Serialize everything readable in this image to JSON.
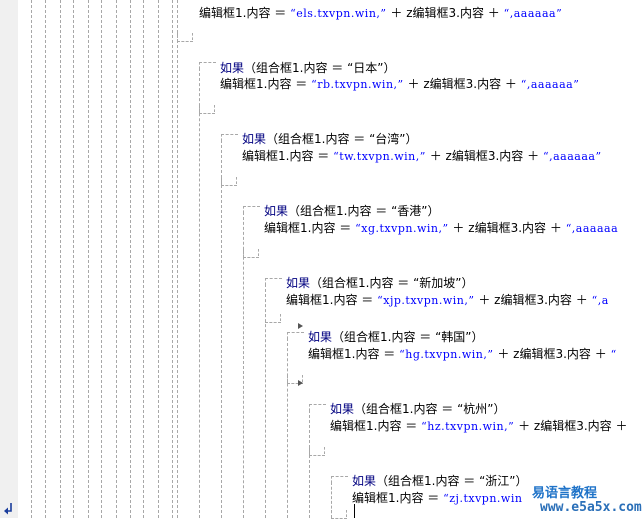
{
  "lines": [
    {
      "field": "编辑框1.内容",
      "op": "＝",
      "str": "“els.txvpn.win,”",
      "plus1": "＋",
      "field3": "z编辑框3.内容",
      "plus2": "＋",
      "tail": "“,aaaaaa”"
    },
    {
      "kw": "如果",
      "cond": "（组合框1.内容 ＝ “日本”）"
    },
    {
      "field": "编辑框1.内容",
      "op": "＝",
      "str": "“rb.txvpn.win,”",
      "plus1": "＋",
      "field3": "z编辑框3.内容",
      "plus2": "＋",
      "tail": "“,aaaaaa”"
    },
    {
      "kw": "如果",
      "cond": "（组合框1.内容 ＝ “台湾”）"
    },
    {
      "field": "编辑框1.内容",
      "op": "＝",
      "str": "“tw.txvpn.win,”",
      "plus1": "＋",
      "field3": "z编辑框3.内容",
      "plus2": "＋",
      "tail": "“,aaaaaa”"
    },
    {
      "kw": "如果",
      "cond": "（组合框1.内容 ＝ “香港”）"
    },
    {
      "field": "编辑框1.内容",
      "op": "＝",
      "str": "“xg.txvpn.win,”",
      "plus1": "＋",
      "field3": "z编辑框3.内容",
      "plus2": "＋",
      "tail": "“,aaaaaa"
    },
    {
      "kw": "如果",
      "cond": "（组合框1.内容 ＝ “新加坡”）"
    },
    {
      "field": "编辑框1.内容",
      "op": "＝",
      "str": "“xjp.txvpn.win,”",
      "plus1": "＋",
      "field3": "z编辑框3.内容",
      "plus2": "＋",
      "tail": "“,a"
    },
    {
      "kw": "如果",
      "cond": "（组合框1.内容 ＝ “韩国”）"
    },
    {
      "field": "编辑框1.内容",
      "op": "＝",
      "str": "“hg.txvpn.win,”",
      "plus1": "＋",
      "field3": "z编辑框3.内容",
      "plus2": "＋",
      "tail": "“"
    },
    {
      "kw": "如果",
      "cond": "（组合框1.内容 ＝ “杭州”）"
    },
    {
      "field": "编辑框1.内容",
      "op": "＝",
      "str": "“hz.txvpn.win,”",
      "plus1": "＋",
      "field3": "z编辑框3.内容",
      "plus2": "＋",
      "tail": ""
    },
    {
      "kw": "如果",
      "cond": "（组合框1.内容 ＝ “浙江”）"
    },
    {
      "field": "编辑框1.内容",
      "op": "＝",
      "str": "“zj.txvpn.win",
      "plus1": "",
      "field3": "",
      "plus2": "",
      "tail": ""
    }
  ],
  "watermark": {
    "line1": "易语言教程",
    "line2": "www.e5a5x.com"
  },
  "icons": {
    "gutter_marker": "step-arrow-icon"
  }
}
